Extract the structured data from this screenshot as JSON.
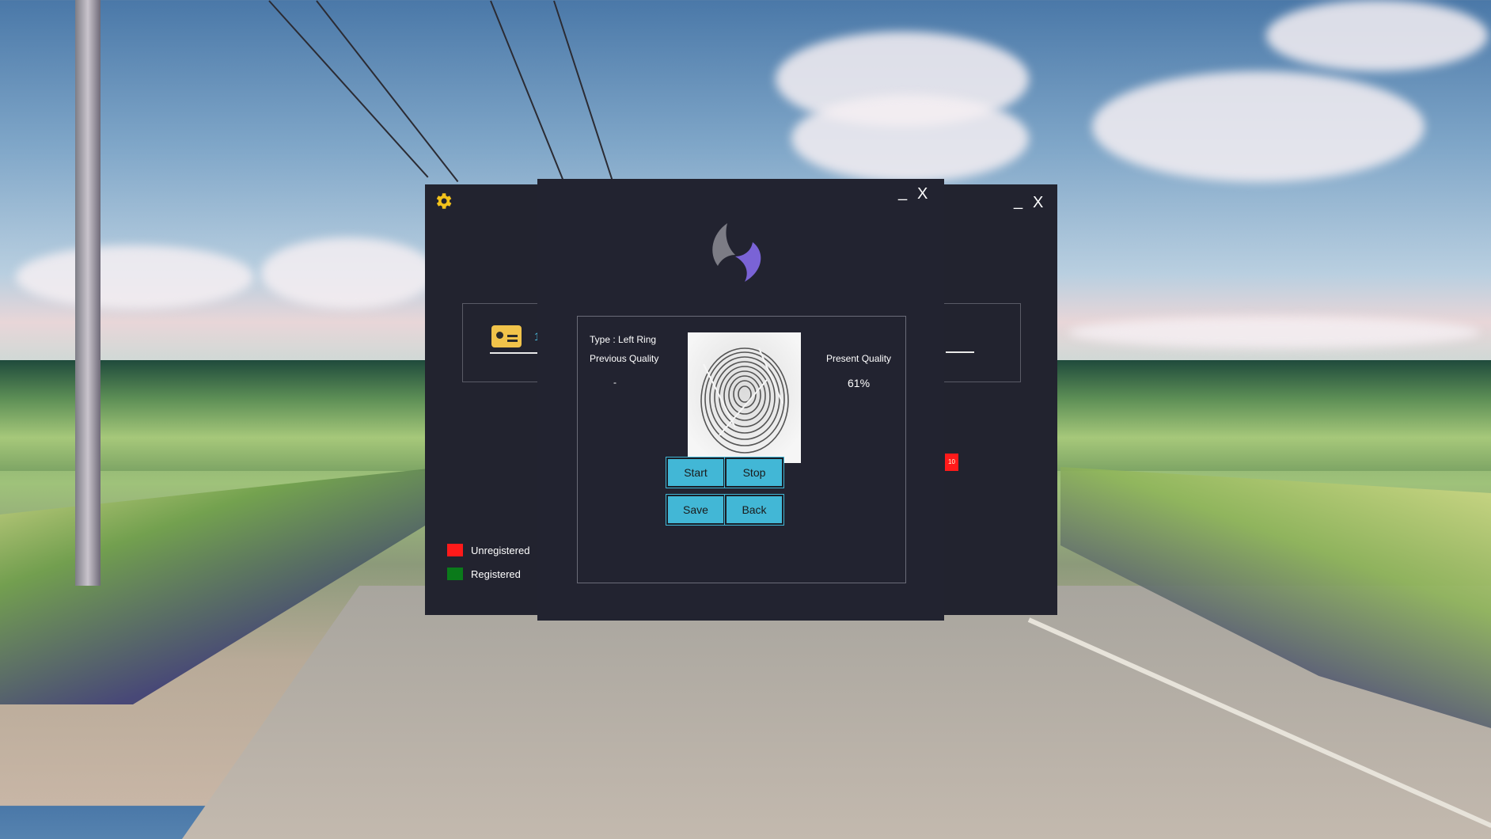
{
  "back_window": {
    "minimize_label": "_",
    "close_label": "X",
    "card_number": "1",
    "status_label": "10",
    "legend": [
      {
        "label": "Unregistered",
        "color": "#ff1a1a"
      },
      {
        "label": "Registered",
        "color": "#0a7a1a"
      }
    ]
  },
  "front_window": {
    "minimize_label": "_",
    "close_label": "X",
    "type_label": "Type : Left Ring",
    "previous_quality_label": "Previous Quality",
    "previous_quality_value": "-",
    "present_quality_label": "Present Quality",
    "present_quality_value": "61%",
    "buttons": {
      "start": "Start",
      "stop": "Stop",
      "save": "Save",
      "back": "Back"
    }
  },
  "colors": {
    "window_bg": "#22232f",
    "button": "#42b7d6",
    "gear": "#f2c21b",
    "logo_gray": "#7c7c85",
    "logo_purple": "#7a63d6"
  },
  "icons": {
    "settings": "gear-icon",
    "id_card": "id-card-icon",
    "app_logo": "app-logo-icon",
    "fingerprint": "fingerprint-image"
  }
}
